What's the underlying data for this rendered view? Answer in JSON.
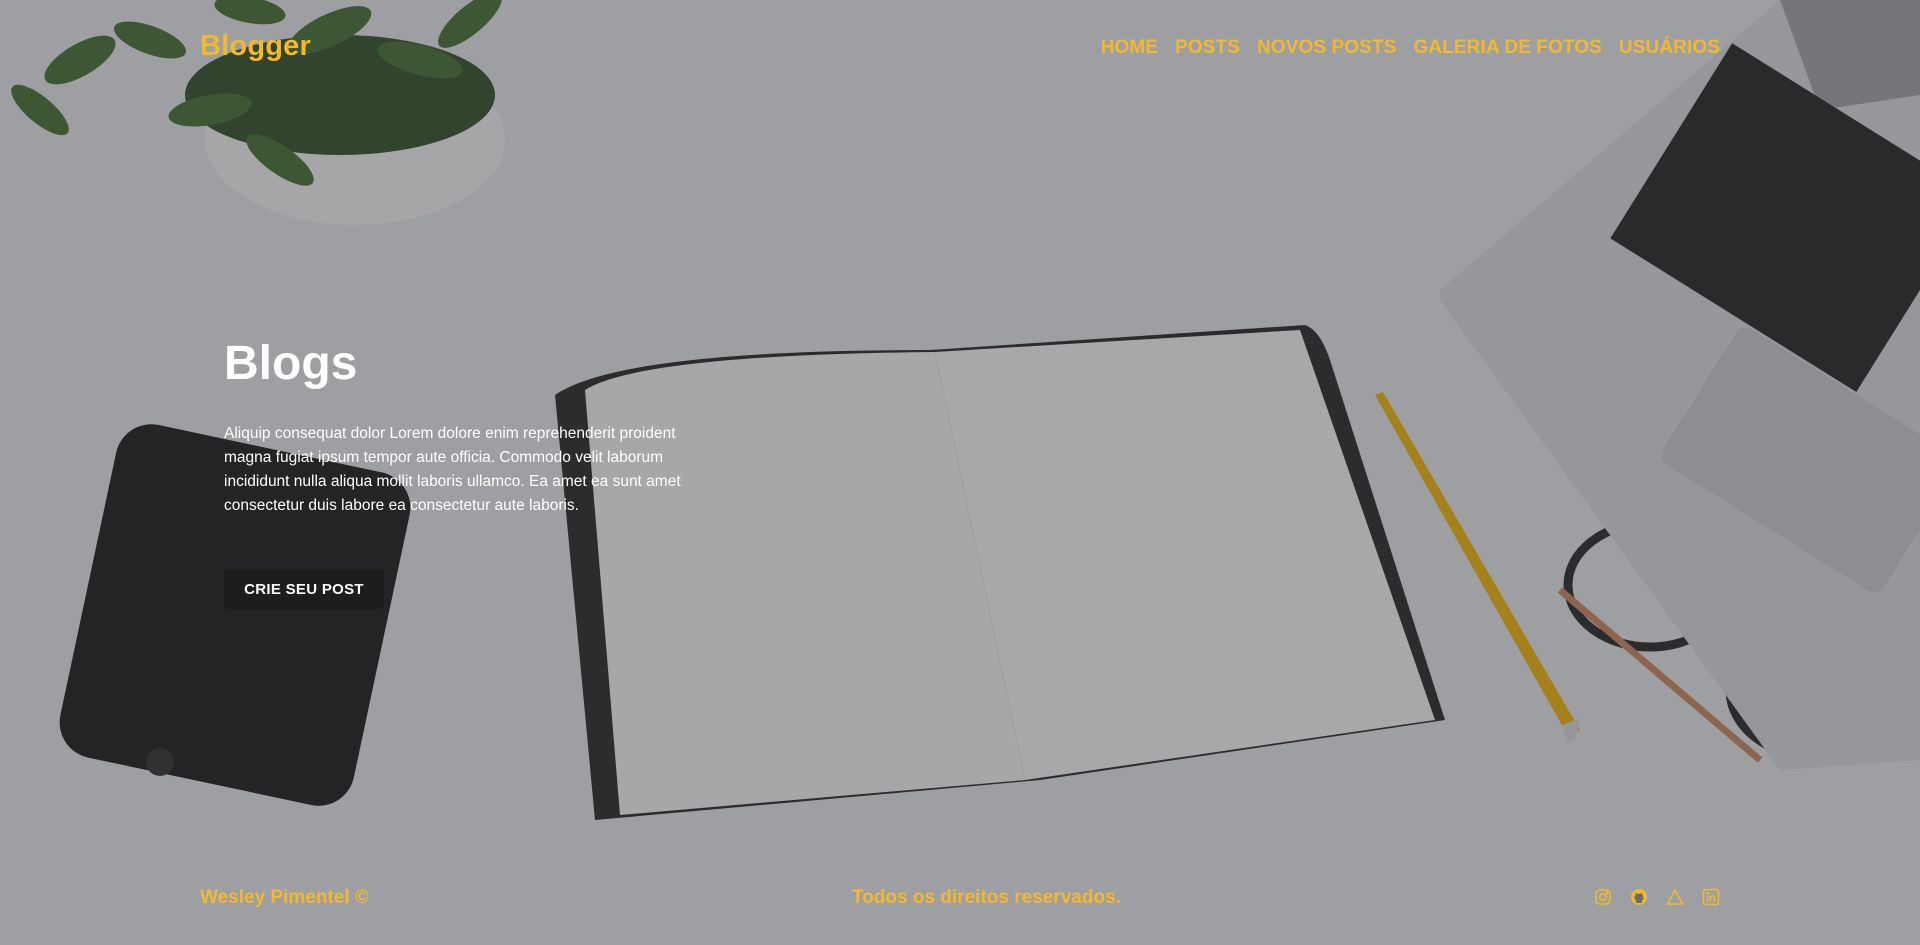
{
  "header": {
    "brand": "Blogger",
    "nav": [
      "HOME",
      "POSTS",
      "NOVOS POSTS",
      "GALERIA DE FOTOS",
      "USUÁRIOS"
    ]
  },
  "hero": {
    "title": "Blogs",
    "description": "Aliquip consequat dolor Lorem dolore enim reprehenderit proident magna fugiat ipsum tempor aute officia. Commodo velit laborum incididunt nulla aliqua mollit laboris ullamco. Ea amet ea sunt amet consectetur duis labore ea consectetur aute laboris.",
    "cta_label": "CRIE SEU POST"
  },
  "footer": {
    "author": "Wesley Pimentel ©",
    "rights": "Todos os direitos reservados.",
    "social_icons": [
      "instagram-icon",
      "github-icon",
      "triangle-icon",
      "linkedin-icon"
    ]
  },
  "colors": {
    "accent": "#f2b92e",
    "button_bg": "#1d1d1d",
    "text_light": "#ffffff"
  }
}
